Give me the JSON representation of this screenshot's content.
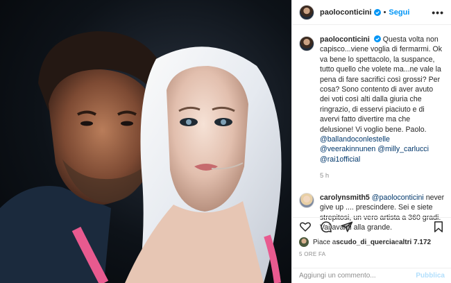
{
  "post": {
    "image_alt": "",
    "header": {
      "username": "paoloconticini",
      "separator": "•",
      "follow_label": "Segui",
      "more_label": "•••"
    },
    "caption": {
      "username": "paoloconticini",
      "text": "Questa volta non capisco...viene voglia di fermarmi. Ok va bene lo spettacolo, la suspance, tutto quello che volete ma...ne vale la pena di fare sacrifici così grossi? Per cosa? Sono contento di aver avuto dei voti così alti dalla giuria che ringrazio, di esservi piaciuto e di avervi fatto divertire ma che delusione! Vi voglio bene. Paolo. ",
      "mentions": [
        "@ballandoconlestelle",
        "@veerakinnunen",
        "@milly_carlucci",
        "@rai1official"
      ],
      "time": "5 h"
    },
    "comment": {
      "username": "carolynsmith5",
      "mention": "@paoloconticini",
      "text": " never give up .... prescindere. Sei e siete strepitosi, un vero artista a 360 gradi. Vai avanti alla grande."
    },
    "likes": {
      "prefix": "Piace a ",
      "user": "scudo_di_quercia",
      "middle": " e ",
      "others": "altri 7.172"
    },
    "posted_ago": "5 ORE FA",
    "add_comment": {
      "placeholder": "Aggiungi un commento...",
      "publish_label": "Pubblica"
    },
    "icons": [
      "verified-icon",
      "heart-icon",
      "comment-icon",
      "share-icon",
      "bookmark-icon"
    ],
    "colors": {
      "accent": "#0095f6",
      "mention": "#00376b",
      "muted": "#8e8e8e",
      "publish_disabled": "#b2dffc"
    }
  }
}
